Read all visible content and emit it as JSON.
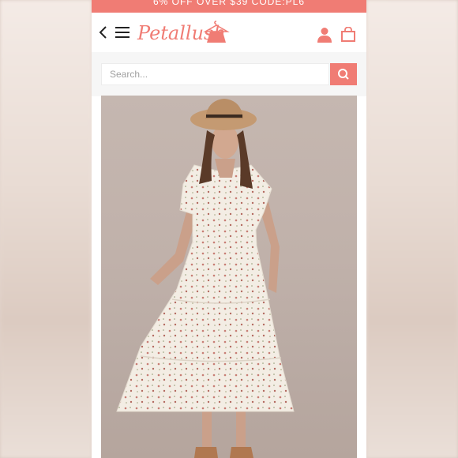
{
  "promo": {
    "text": "6% OFF OVER $39 CODE:PL6"
  },
  "header": {
    "logo_text": "Petallush",
    "icons": [
      "back-arrow-icon",
      "hamburger-menu-icon",
      "user-icon",
      "shopping-bag-icon"
    ]
  },
  "search": {
    "placeholder": "Search..."
  },
  "product": {
    "image": "model wearing a white short-sleeve floral tiered midi dress and a tan wide-brim hat"
  },
  "colors": {
    "accent": "#f07c74",
    "photo_background": "#c0b1aa"
  }
}
